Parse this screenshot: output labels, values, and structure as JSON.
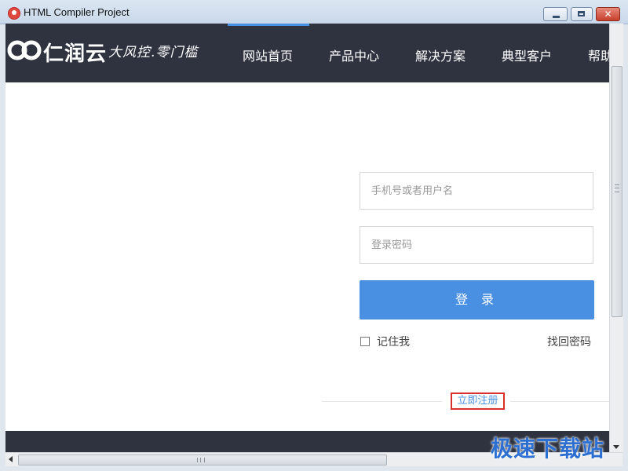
{
  "window": {
    "title": "HTML Compiler Project"
  },
  "colors": {
    "header_bg": "#2f3340",
    "accent": "#4a90e2",
    "highlight_border": "#d9302c"
  },
  "header": {
    "logo_text": "仁润云",
    "slogan": "大风控.零门槛",
    "nav": [
      "网站首页",
      "产品中心",
      "解决方案",
      "典型客户",
      "帮助"
    ]
  },
  "login": {
    "username_placeholder": "手机号或者用户名",
    "password_placeholder": "登录密码",
    "login_button": "登 录",
    "remember_label": "记住我",
    "forgot_link": "找回密码",
    "register_link": "立即注册"
  },
  "watermark": "极速下载站"
}
